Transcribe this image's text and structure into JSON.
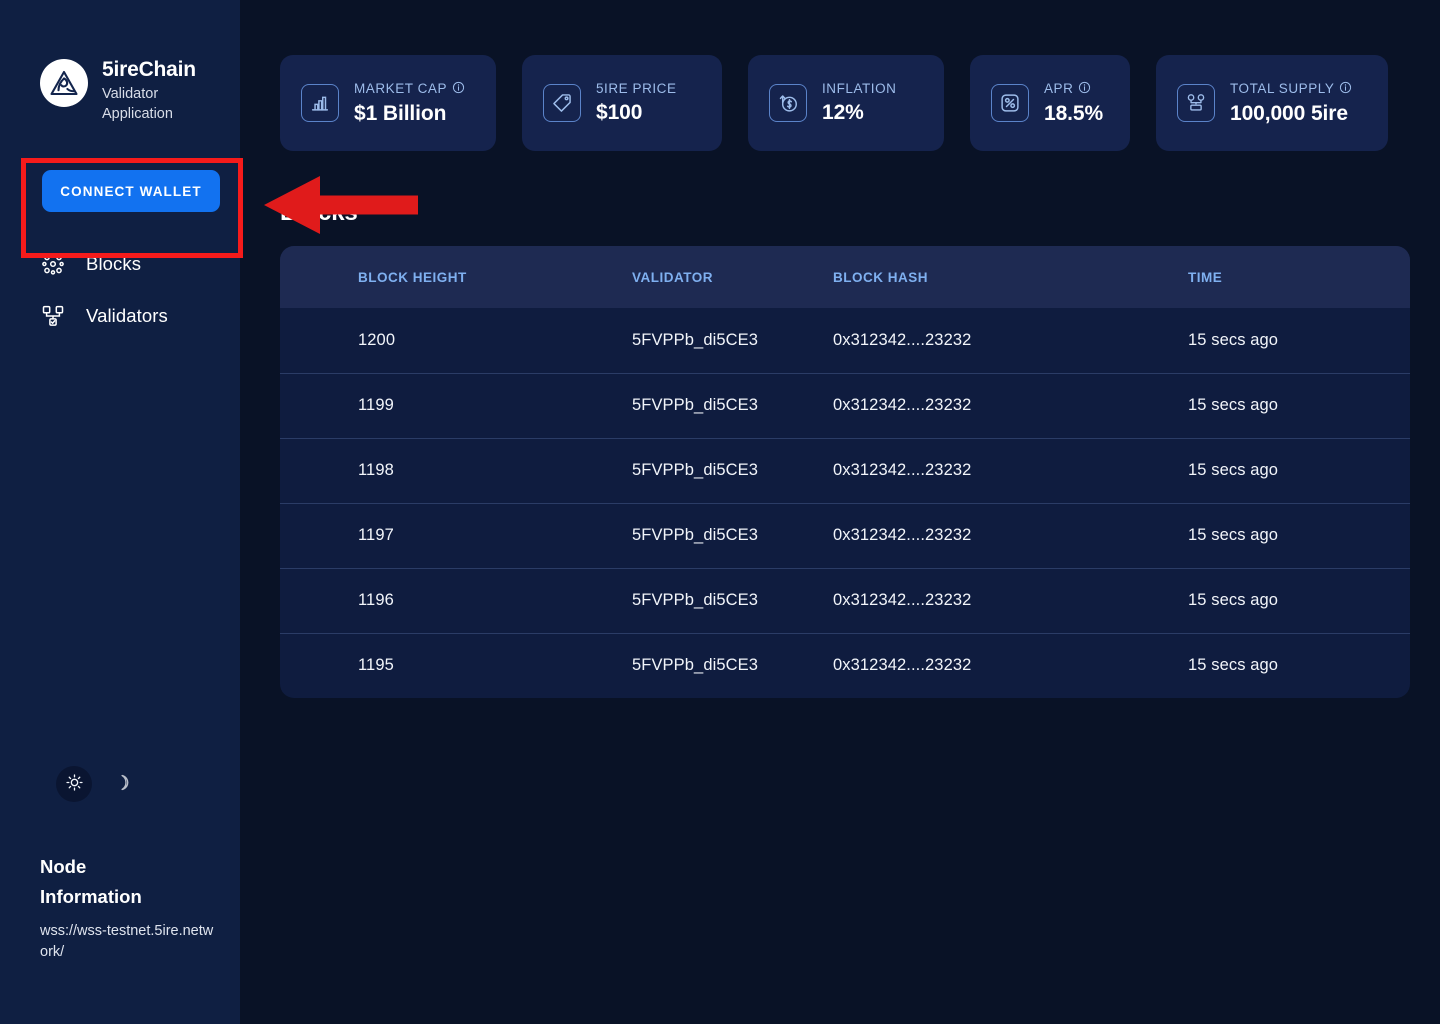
{
  "brand": {
    "logo_icon": "5ire-triangle-logo",
    "title": "5ireChain",
    "subtitle": "Validator Application"
  },
  "sidebar": {
    "connect_wallet_label": "CONNECT WALLET",
    "items": [
      {
        "label": "Blocks",
        "icon": "blocks-cluster-icon"
      },
      {
        "label": "Validators",
        "icon": "validators-network-icon"
      }
    ],
    "theme": {
      "light_icon": "sun-icon",
      "dark_icon": "moon-icon",
      "active": "light"
    },
    "node_information": {
      "title": "Node Information",
      "url": "wss://wss-testnet.5ire.network/"
    }
  },
  "stats": [
    {
      "label": "MARKET CAP",
      "value": "$1 Billion",
      "icon": "bar-chart-icon",
      "info": true
    },
    {
      "label": "5IRE PRICE",
      "value": "$100",
      "icon": "price-tag-icon",
      "info": false
    },
    {
      "label": "INFLATION",
      "value": "12%",
      "icon": "inflation-dollar-icon",
      "info": false
    },
    {
      "label": "APR",
      "value": "18.5%",
      "icon": "percent-icon",
      "info": true
    },
    {
      "label": "TOTAL SUPPLY",
      "value": "100,000 5ire",
      "icon": "supply-network-icon",
      "info": true
    }
  ],
  "blocks_section": {
    "title": "Blocks",
    "columns": [
      "BLOCK HEIGHT",
      "VALIDATOR",
      "BLOCK HASH",
      "TIME"
    ],
    "rows": [
      {
        "height": "1200",
        "validator": "5FVPPb_di5CE3",
        "hash": "0x312342....23232",
        "time": "15 secs ago"
      },
      {
        "height": "1199",
        "validator": "5FVPPb_di5CE3",
        "hash": "0x312342....23232",
        "time": "15 secs ago"
      },
      {
        "height": "1198",
        "validator": "5FVPPb_di5CE3",
        "hash": "0x312342....23232",
        "time": "15 secs ago"
      },
      {
        "height": "1197",
        "validator": "5FVPPb_di5CE3",
        "hash": "0x312342....23232",
        "time": "15 secs ago"
      },
      {
        "height": "1196",
        "validator": "5FVPPb_di5CE3",
        "hash": "0x312342....23232",
        "time": "15 secs ago"
      },
      {
        "height": "1195",
        "validator": "5FVPPb_di5CE3",
        "hash": "0x312342....23232",
        "time": "15 secs ago"
      }
    ]
  },
  "annotations": {
    "highlight_target": "connect-wallet-button",
    "box_color": "#f61b1b",
    "arrow_color": "#e01b1b"
  },
  "colors": {
    "accent_blue": "#1272f0",
    "sidebar_bg": "#0f1f42",
    "main_bg": "#091226",
    "card_bg": "#15234d",
    "table_bg": "#0f1c3f",
    "table_header_bg": "#1e2a52",
    "header_text": "#7fb0f0",
    "label_text": "#9dbcea"
  }
}
